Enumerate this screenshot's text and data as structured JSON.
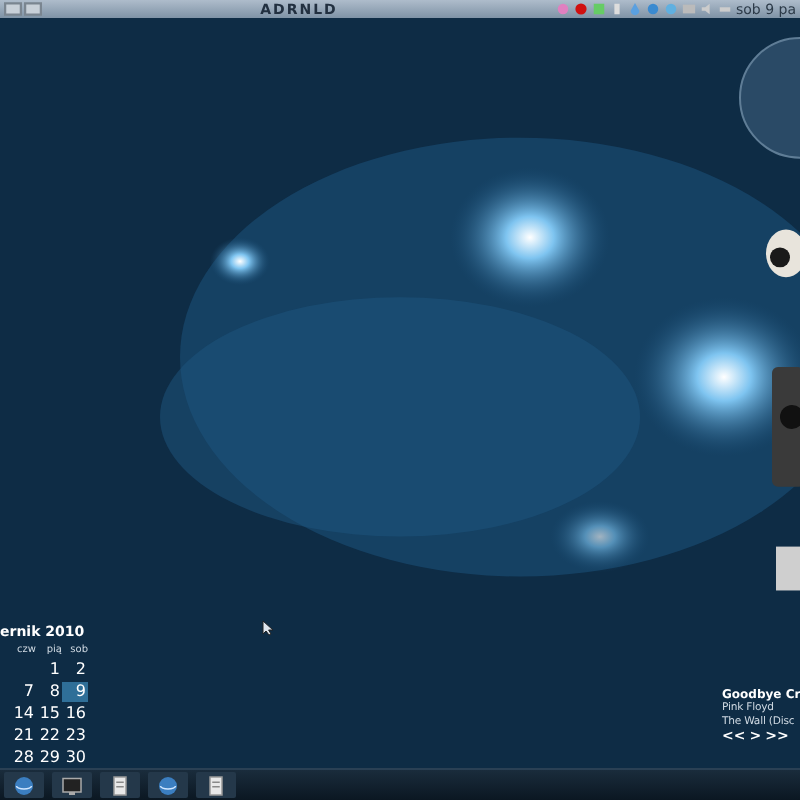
{
  "top_panel": {
    "title": "ADRNLD",
    "clock": "sob 9 pa"
  },
  "calendar": {
    "title": "ernik 2010",
    "weekdays": [
      "czw",
      "pią",
      "sob"
    ],
    "weeks": [
      [
        {
          "text": "1",
          "selected": false
        },
        {
          "text": "2",
          "selected": false
        }
      ],
      [
        {
          "text": "7",
          "selected": false
        },
        {
          "text": "8",
          "selected": false
        },
        {
          "text": "9",
          "selected": true
        }
      ],
      [
        {
          "text": "14",
          "selected": false
        },
        {
          "text": "15",
          "selected": false
        },
        {
          "text": "16",
          "selected": false
        }
      ],
      [
        {
          "text": "21",
          "selected": false
        },
        {
          "text": "22",
          "selected": false
        },
        {
          "text": "23",
          "selected": false
        }
      ],
      [
        {
          "text": "28",
          "selected": false
        },
        {
          "text": "29",
          "selected": false
        },
        {
          "text": "30",
          "selected": false
        }
      ]
    ]
  },
  "media_player": {
    "track": "Goodbye Cr",
    "artist": "Pink Floyd",
    "album": "The Wall (Disc",
    "controls": [
      "<<",
      ">",
      ">>"
    ]
  },
  "taskbar": {
    "tasks": [
      {
        "kind": "globe"
      },
      {
        "kind": "terminal"
      },
      {
        "kind": "document"
      },
      {
        "kind": "globe"
      },
      {
        "kind": "document"
      }
    ]
  }
}
